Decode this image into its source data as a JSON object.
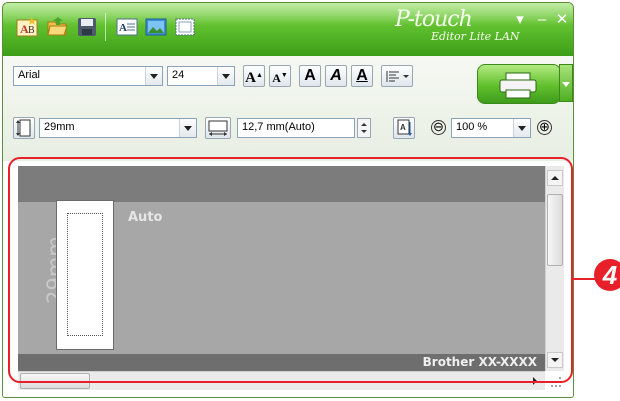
{
  "app": {
    "brand": "P-touch",
    "edition": "Editor Lite LAN",
    "accent": "#5fbf2e",
    "callout_color": "#e8202a"
  },
  "titlebar": {
    "quick_access": [
      {
        "name": "new-label-icon"
      },
      {
        "name": "open-folder-icon"
      },
      {
        "name": "save-icon"
      },
      {
        "name": "text-icon"
      },
      {
        "name": "image-icon"
      },
      {
        "name": "frame-icon"
      }
    ],
    "controls": [
      "▾",
      "–",
      "✕"
    ]
  },
  "toolbar": {
    "font_name": "Arial",
    "font_size": "24",
    "grow_label": "A",
    "shrink_label": "A",
    "bold_label": "A",
    "italic_label": "A",
    "underline_label": "A",
    "tape_width": "29mm",
    "label_length": "12,7 mm(Auto)",
    "zoom": "100 %",
    "zoom_out": "⊖",
    "zoom_in": "⊕"
  },
  "canvas": {
    "tape_size_label": "29mm",
    "length_label": "Auto",
    "printer_name": "Brother XX-XXXX"
  },
  "callout": {
    "number": "4"
  }
}
